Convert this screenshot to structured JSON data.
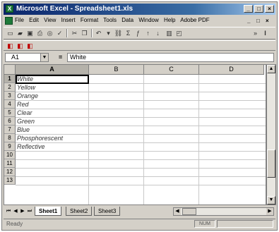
{
  "window": {
    "title": "Microsoft Excel - Spreadsheet1.xls",
    "controls": [
      "_",
      "□",
      "×"
    ]
  },
  "menu": {
    "items": [
      "File",
      "Edit",
      "View",
      "Insert",
      "Format",
      "Tools",
      "Data",
      "Window",
      "Help",
      "Adobe PDF"
    ],
    "doc_controls": [
      "_",
      "□",
      "×"
    ]
  },
  "toolbar": {
    "standard_icons": [
      "new-icon",
      "open-icon",
      "save-icon",
      "print-icon",
      "print-preview-icon",
      "spelling-icon",
      "cut-icon",
      "copy-icon",
      "undo-icon",
      "hyperlink-icon",
      "autosum-icon",
      "sort-ascending-icon",
      "sort-descending-icon",
      "chart-wizard-icon",
      "drawing-icon"
    ],
    "formatting_icons": [
      "pdf-icon",
      "pdf-email-icon",
      "pdf-review-icon"
    ]
  },
  "formula_bar": {
    "name_box": "A1",
    "fx": "=",
    "value": "White"
  },
  "grid": {
    "columns": [
      "A",
      "B",
      "C",
      "D"
    ],
    "rows": [
      "1",
      "2",
      "3",
      "4",
      "5",
      "6",
      "7",
      "8",
      "9",
      "10",
      "11",
      "12",
      "13"
    ],
    "column_a": [
      "White",
      "Yellow",
      "Orange",
      "Red",
      "Clear",
      "Green",
      "Blue",
      "Phosphorescent",
      "Reflective",
      "",
      "",
      "",
      ""
    ],
    "active_cell": "A1"
  },
  "sheets": {
    "tabs": [
      "Sheet1",
      "Sheet2",
      "Sheet3"
    ],
    "active": "Sheet1"
  },
  "status": {
    "text": "Ready",
    "panel": "NUM"
  }
}
